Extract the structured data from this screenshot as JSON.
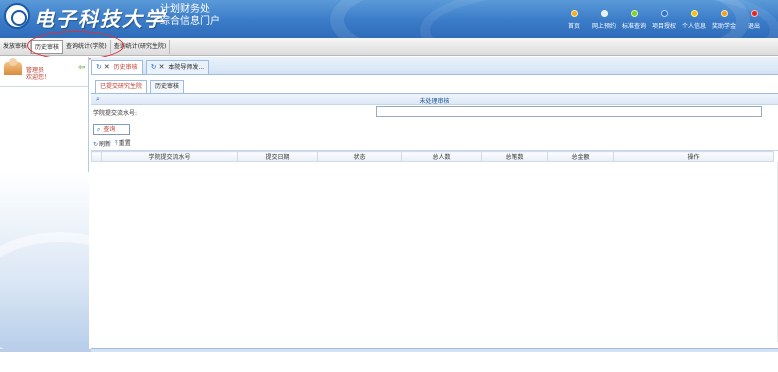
{
  "header": {
    "university": "电子科技大学",
    "dept_line1": "计划财务处",
    "dept_line2": "综合信息门户",
    "nav": [
      {
        "label": "首页",
        "color": "#f2b01e"
      },
      {
        "label": "网上预约",
        "color": "#e8edf5"
      },
      {
        "label": "标准查询",
        "color": "#7ed321"
      },
      {
        "label": "项目授权",
        "color": "#2d6fd2"
      },
      {
        "label": "个人信息",
        "color": "#f5c400"
      },
      {
        "label": "奖助学金",
        "color": "#f0a020"
      },
      {
        "label": "退出",
        "color": "#e02828"
      }
    ]
  },
  "menubar": {
    "items": [
      {
        "label": "发放审核",
        "active": false
      },
      {
        "label": "历史审核",
        "active": true
      },
      {
        "label": "查询统计(学院)",
        "active": false
      },
      {
        "label": "查询统计(研究生院)",
        "active": false
      }
    ]
  },
  "sidebar": {
    "user_line1": "管理员",
    "user_line2": "欢迎您！"
  },
  "tabs": [
    {
      "label": "历史审核",
      "active": true
    },
    {
      "label": "本院导师发...",
      "active": false
    }
  ],
  "subtabs": [
    {
      "label": "已提交研究生院",
      "active": true
    },
    {
      "label": "历史审核",
      "active": false
    }
  ],
  "panel": {
    "title": "未处理审核",
    "search_label": "学院提交流水号:",
    "search_value": "",
    "query_button": "查询",
    "refresh_button": "刷新",
    "reset_button": "重置"
  },
  "grid": {
    "columns": [
      "学院提交流水号",
      "提交日期",
      "状态",
      "总人数",
      "总笔数",
      "总金额",
      "操作"
    ]
  }
}
